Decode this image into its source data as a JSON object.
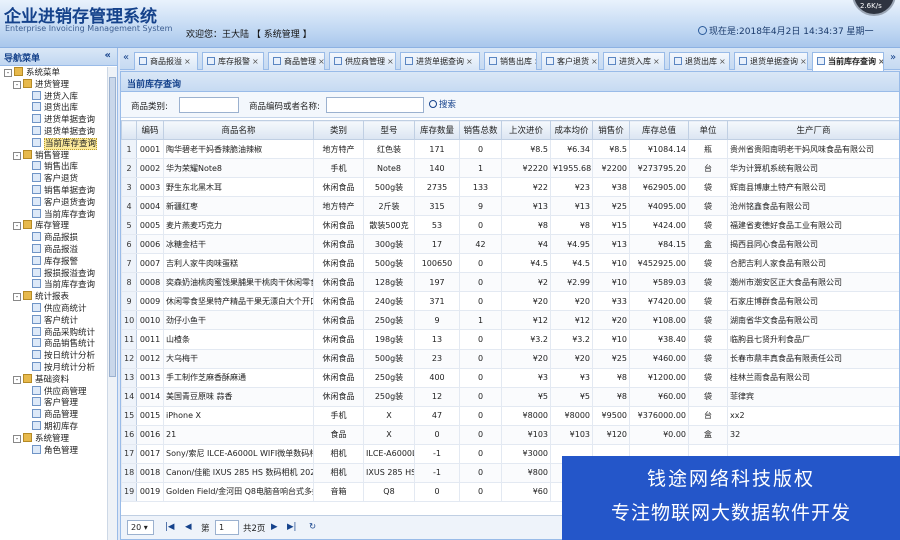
{
  "header": {
    "title": "企业进销存管理系统",
    "subtitle": "Enterprise Invoicing Management System",
    "welcome": "欢迎您：王大陆 【 系统管理 】",
    "clock": "现在是:2018年4月2日 14:34:37 星期一",
    "gauge": "2.6K/s"
  },
  "sidebar": {
    "title": "导航菜单",
    "collapse": "«",
    "tree": [
      {
        "label": "系统菜单",
        "level": 0,
        "type": "folder",
        "exp": "-"
      },
      {
        "label": "进货管理",
        "level": 1,
        "type": "folder",
        "exp": "-"
      },
      {
        "label": "进货入库",
        "level": 2,
        "type": "leaf"
      },
      {
        "label": "退货出库",
        "level": 2,
        "type": "leaf"
      },
      {
        "label": "进货单据查询",
        "level": 2,
        "type": "leaf"
      },
      {
        "label": "退货单据查询",
        "level": 2,
        "type": "leaf"
      },
      {
        "label": "当前库存查询",
        "level": 2,
        "type": "leaf",
        "selected": true
      },
      {
        "label": "销售管理",
        "level": 1,
        "type": "folder",
        "exp": "-"
      },
      {
        "label": "销售出库",
        "level": 2,
        "type": "leaf"
      },
      {
        "label": "客户退货",
        "level": 2,
        "type": "leaf"
      },
      {
        "label": "销售单据查询",
        "level": 2,
        "type": "leaf"
      },
      {
        "label": "客户退货查询",
        "level": 2,
        "type": "leaf"
      },
      {
        "label": "当前库存查询",
        "level": 2,
        "type": "leaf"
      },
      {
        "label": "库存管理",
        "level": 1,
        "type": "folder",
        "exp": "-"
      },
      {
        "label": "商品报损",
        "level": 2,
        "type": "leaf"
      },
      {
        "label": "商品报溢",
        "level": 2,
        "type": "leaf"
      },
      {
        "label": "库存报警",
        "level": 2,
        "type": "leaf"
      },
      {
        "label": "报损报溢查询",
        "level": 2,
        "type": "leaf"
      },
      {
        "label": "当前库存查询",
        "level": 2,
        "type": "leaf"
      },
      {
        "label": "统计报表",
        "level": 1,
        "type": "folder",
        "exp": "-"
      },
      {
        "label": "供应商统计",
        "level": 2,
        "type": "leaf"
      },
      {
        "label": "客户统计",
        "level": 2,
        "type": "leaf"
      },
      {
        "label": "商品采购统计",
        "level": 2,
        "type": "leaf"
      },
      {
        "label": "商品销售统计",
        "level": 2,
        "type": "leaf"
      },
      {
        "label": "按日统计分析",
        "level": 2,
        "type": "leaf"
      },
      {
        "label": "按月统计分析",
        "level": 2,
        "type": "leaf"
      },
      {
        "label": "基础资料",
        "level": 1,
        "type": "folder",
        "exp": "-"
      },
      {
        "label": "供应商管理",
        "level": 2,
        "type": "leaf"
      },
      {
        "label": "客户管理",
        "level": 2,
        "type": "leaf"
      },
      {
        "label": "商品管理",
        "level": 2,
        "type": "leaf"
      },
      {
        "label": "期初库存",
        "level": 2,
        "type": "leaf"
      },
      {
        "label": "系统管理",
        "level": 1,
        "type": "folder",
        "exp": "-"
      },
      {
        "label": "角色管理",
        "level": 2,
        "type": "leaf"
      }
    ]
  },
  "tabs": {
    "scroll_left": "«",
    "scroll_right": "»",
    "items": [
      {
        "label": "商品报溢",
        "active": false
      },
      {
        "label": "库存报警",
        "active": false
      },
      {
        "label": "商品管理",
        "active": false
      },
      {
        "label": "供应商管理",
        "active": false
      },
      {
        "label": "进货单据查询",
        "active": false
      },
      {
        "label": "销售出库",
        "active": false
      },
      {
        "label": "客户退货",
        "active": false
      },
      {
        "label": "进货入库",
        "active": false
      },
      {
        "label": "退货出库",
        "active": false
      },
      {
        "label": "退货单据查询",
        "active": false
      },
      {
        "label": "当前库存查询",
        "active": true
      }
    ],
    "close": "×"
  },
  "panel": {
    "title": "当前库存查询",
    "category_label": "商品类别:",
    "category_value": "",
    "name_label": "商品编码或者名称:",
    "name_value": "",
    "search_label": "搜索"
  },
  "table": {
    "columns": [
      "编码",
      "商品名称",
      "类别",
      "型号",
      "库存数量",
      "销售总数",
      "上次进价",
      "成本均价",
      "销售价",
      "库存总值",
      "单位",
      "生产厂商"
    ],
    "rows": [
      [
        "1",
        "0001",
        "陶华碧老干妈香辣脆油辣椒",
        "地方特产",
        "红色装",
        "171",
        "0",
        "¥8.5",
        "¥6.34",
        "¥8.5",
        "¥1084.14",
        "瓶",
        "贵州省贵阳南明老干妈风味食品有限公司"
      ],
      [
        "2",
        "0002",
        "华为荣耀Note8",
        "手机",
        "Note8",
        "140",
        "1",
        "¥2220",
        "¥1955.68",
        "¥2200",
        "¥273795.20",
        "台",
        "华为计算机系统有限公司"
      ],
      [
        "3",
        "0003",
        "野生东北黑木耳",
        "休闲食品",
        "500g装",
        "2735",
        "133",
        "¥22",
        "¥23",
        "¥38",
        "¥62905.00",
        "袋",
        "辉南县博康土特产有限公司"
      ],
      [
        "4",
        "0004",
        "新疆红枣",
        "地方特产",
        "2斤装",
        "315",
        "9",
        "¥13",
        "¥13",
        "¥25",
        "¥4095.00",
        "袋",
        "沧州铭鑫食品有限公司"
      ],
      [
        "5",
        "0005",
        "麦片燕麦巧克力",
        "休闲食品",
        "散装500克",
        "53",
        "0",
        "¥8",
        "¥8",
        "¥15",
        "¥424.00",
        "袋",
        "福建省麦德好食品工业有限公司"
      ],
      [
        "6",
        "0006",
        "冰糖金桔干",
        "休闲食品",
        "300g装",
        "17",
        "42",
        "¥4",
        "¥4.95",
        "¥13",
        "¥84.15",
        "盒",
        "揭西县同心食品有限公司"
      ],
      [
        "7",
        "0007",
        "吉利人家牛肉味蛋糕",
        "休闲食品",
        "500g装",
        "100650",
        "0",
        "¥4.5",
        "¥4.5",
        "¥10",
        "¥452925.00",
        "袋",
        "合肥吉利人家食品有限公司"
      ],
      [
        "8",
        "0008",
        "奕森奶油桃肉蜜饯果脯果干桃肉干休闲零食",
        "休闲食品",
        "128g装",
        "197",
        "0",
        "¥2",
        "¥2.99",
        "¥10",
        "¥589.03",
        "袋",
        "潮州市潮安区正大食品有限公司"
      ],
      [
        "9",
        "0009",
        "休闲零食坚果特产精品干果无漂白大个开口",
        "休闲食品",
        "240g装",
        "371",
        "0",
        "¥20",
        "¥20",
        "¥33",
        "¥7420.00",
        "袋",
        "石家庄博群食品有限公司"
      ],
      [
        "10",
        "0010",
        "劲仔小鱼干",
        "休闲食品",
        "250g装",
        "9",
        "1",
        "¥12",
        "¥12",
        "¥20",
        "¥108.00",
        "袋",
        "湖南省华文食品有限公司"
      ],
      [
        "11",
        "0011",
        "山楂条",
        "休闲食品",
        "198g装",
        "13",
        "0",
        "¥3.2",
        "¥3.2",
        "¥10",
        "¥38.40",
        "袋",
        "临朐县七贤升利食品厂"
      ],
      [
        "12",
        "0012",
        "大乌梅干",
        "休闲食品",
        "500g装",
        "23",
        "0",
        "¥20",
        "¥20",
        "¥25",
        "¥460.00",
        "袋",
        "长春市鼎丰真食品有限责任公司"
      ],
      [
        "13",
        "0013",
        "手工制作芝麻香酥麻通",
        "休闲食品",
        "250g装",
        "400",
        "0",
        "¥3",
        "¥3",
        "¥8",
        "¥1200.00",
        "袋",
        "桂林兰雨食品有限公司"
      ],
      [
        "14",
        "0014",
        "美国青豆原味 蒜香",
        "休闲食品",
        "250g装",
        "12",
        "0",
        "¥5",
        "¥5",
        "¥8",
        "¥60.00",
        "袋",
        "菲律宾"
      ],
      [
        "15",
        "0015",
        "iPhone X",
        "手机",
        "X",
        "47",
        "0",
        "¥8000",
        "¥8000",
        "¥9500",
        "¥376000.00",
        "台",
        "xx2"
      ],
      [
        "16",
        "0016",
        "21",
        "食品",
        "X",
        "0",
        "0",
        "¥103",
        "¥103",
        "¥120",
        "¥0.00",
        "盒",
        "32"
      ],
      [
        "17",
        "0017",
        "Sony/索尼 ILCE-A6000L WIFI微单数码相机",
        "相机",
        "ILCE-A6000L",
        "-1",
        "0",
        "¥3000",
        "",
        "",
        "",
        "",
        ""
      ],
      [
        "18",
        "0018",
        "Canon/佳能 IXUS 285 HS 数码相机 2020万",
        "相机",
        "IXUS 285 HS",
        "-1",
        "0",
        "¥800",
        "",
        "",
        "",
        "",
        ""
      ],
      [
        "19",
        "0019",
        "Golden Field/金河田 Q8电脑音响台式多媒体",
        "音箱",
        "Q8",
        "0",
        "0",
        "¥60",
        "",
        "",
        "",
        "",
        ""
      ]
    ]
  },
  "pager": {
    "page_size": "20",
    "page_prefix": "第",
    "page_value": "1",
    "page_total": "共2页",
    "first": "|◀",
    "prev": "◀",
    "next": "▶",
    "last": "▶|",
    "refresh": "↻"
  },
  "watermark": {
    "line1": "钱途网络科技版权",
    "line2": "专注物联网大数据软件开发"
  }
}
